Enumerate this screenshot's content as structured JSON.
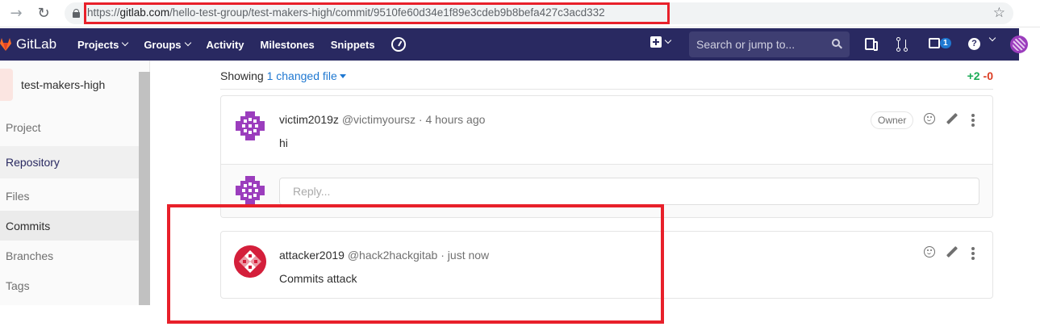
{
  "browser": {
    "back_icon": "arrow-left-icon",
    "reload_icon": "reload-icon",
    "url_scheme": "https://",
    "url_domain": "gitlab.com",
    "url_path": "/hello-test-group/test-makers-high/commit/9510fe60d34e1f89e3cdeb9b8befa427c3acd332",
    "bookmark_icon": "star-icon"
  },
  "navbar": {
    "brand": "GitLab",
    "links": {
      "projects": "Projects",
      "groups": "Groups",
      "activity": "Activity",
      "milestones": "Milestones",
      "snippets": "Snippets"
    },
    "search_placeholder": "Search or jump to...",
    "todo_count": "1",
    "help_glyph": "?"
  },
  "sidebar": {
    "project_name": "test-makers-high",
    "items": {
      "project": "Project",
      "repository": "Repository",
      "files": "Files",
      "commits": "Commits",
      "branches": "Branches",
      "tags": "Tags"
    }
  },
  "diff": {
    "showing_prefix": "Showing",
    "changed_files": "1 changed file",
    "additions": "+2",
    "deletions": "-0"
  },
  "notes": [
    {
      "author": "victim2019z",
      "handle": "@victimyoursz",
      "time": "· 4 hours ago",
      "body": "hi",
      "role": "Owner"
    },
    {
      "author": "attacker2019",
      "handle": "@hack2hackgitab",
      "time": "· just now",
      "body": "Commits attack"
    }
  ],
  "reply": {
    "placeholder": "Reply..."
  },
  "colors": {
    "navbar_bg": "#292961",
    "link": "#1f78d1",
    "addition": "#1aaa55",
    "deletion": "#db3b21",
    "highlight": "#e8202a"
  }
}
